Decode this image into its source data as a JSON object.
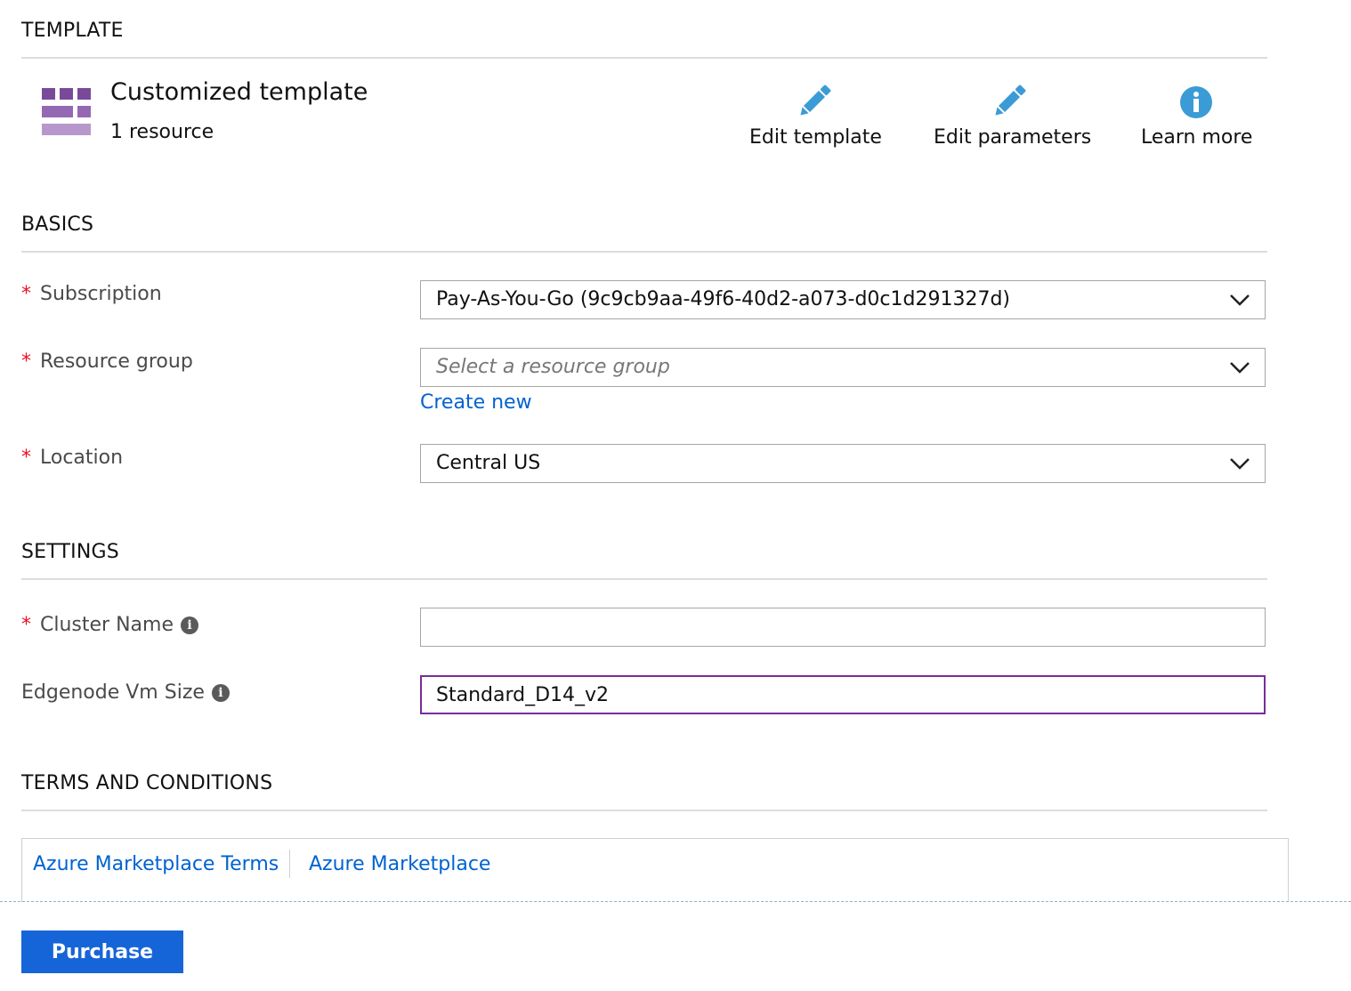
{
  "template": {
    "section_title": "TEMPLATE",
    "name": "Customized template",
    "resource_count": "1 resource",
    "actions": [
      {
        "label": "Edit template",
        "icon": "pencil-icon"
      },
      {
        "label": "Edit parameters",
        "icon": "pencil-icon"
      },
      {
        "label": "Learn more",
        "icon": "info-icon"
      }
    ]
  },
  "basics": {
    "section_title": "BASICS",
    "subscription": {
      "label": "Subscription",
      "value": "Pay-As-You-Go (9c9cb9aa-49f6-40d2-a073-d0c1d291327d)"
    },
    "resource_group": {
      "label": "Resource group",
      "placeholder": "Select a resource group",
      "create_new": "Create new"
    },
    "location": {
      "label": "Location",
      "value": "Central US"
    }
  },
  "settings": {
    "section_title": "SETTINGS",
    "cluster_name": {
      "label": "Cluster Name",
      "value": ""
    },
    "edgenode_vm_size": {
      "label": "Edgenode Vm Size",
      "value": "Standard_D14_v2"
    }
  },
  "terms": {
    "section_title": "TERMS AND CONDITIONS",
    "links": [
      "Azure Marketplace Terms",
      "Azure Marketplace"
    ]
  },
  "footer": {
    "purchase_label": "Purchase"
  },
  "colors": {
    "required": "#e81123",
    "link": "#0063d1",
    "button": "#1665d8",
    "focus_border": "#7a2c99",
    "icon_blue": "#3b9bd6",
    "template_icon": "#8a5aa8"
  }
}
